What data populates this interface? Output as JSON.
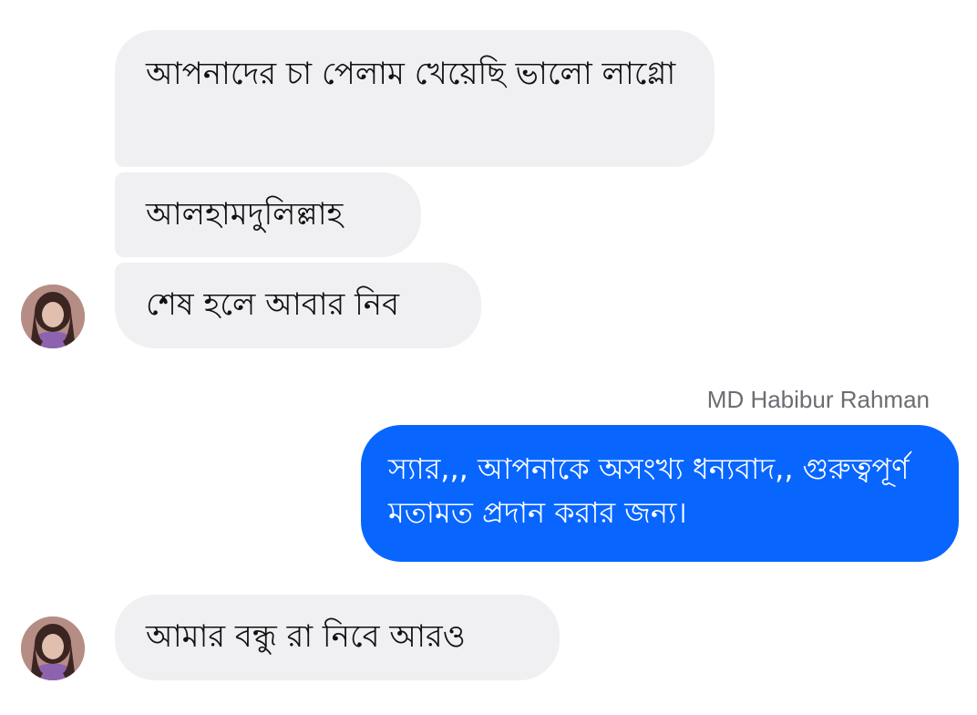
{
  "conversation": {
    "messages": [
      {
        "text": "আপনাদের চা পেলাম খেয়েছি ভালো লাগ্লো"
      },
      {
        "text": "আলহামদুলিল্লাহ"
      },
      {
        "text": "শেষ হলে আবার নিব"
      },
      {
        "text": "স্যার,,, আপনাকে অসংখ্য ধন্যবাদ,, গুরুত্বপূর্ণ মতামত প্রদান করার জন্য।"
      },
      {
        "text": "আমার বন্ধু রা নিবে আরও"
      }
    ],
    "outgoing_sender_name": "MD Habibur Rahman"
  },
  "colors": {
    "incoming_bubble": "#f0f0f2",
    "outgoing_bubble": "#0866ff",
    "sender_name": "#6b6d72"
  }
}
